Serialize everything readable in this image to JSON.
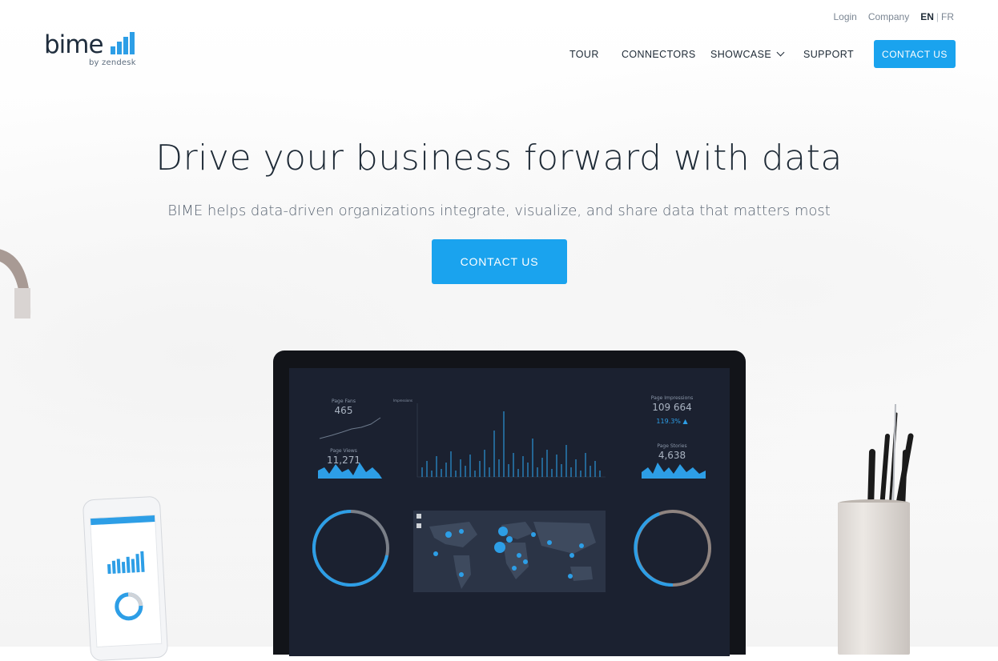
{
  "brand": {
    "logo_word": "bime",
    "logo_sub": "by zendesk",
    "accent": "#1aa3ee"
  },
  "utility_nav": {
    "login": "Login",
    "company": "Company",
    "lang_active": "EN",
    "separator": "|",
    "lang_other": "FR"
  },
  "nav": {
    "items": [
      {
        "label": "TOUR"
      },
      {
        "label": "CONNECTORS"
      },
      {
        "label": "SHOWCASE",
        "icon": "chevron-down-icon"
      },
      {
        "label": "SUPPORT"
      }
    ],
    "cta": "CONTACT US"
  },
  "hero": {
    "title": "Drive your business forward with data",
    "subtitle": "BIME helps data-driven organizations integrate, visualize, and share data that matters most",
    "cta": "CONTACT US"
  },
  "dashboard": {
    "page_fans_label": "Page Fans",
    "page_fans_value": "465",
    "page_views_label": "Page Views",
    "page_views_value": "11,271",
    "impressions_chart_label": "Impressions",
    "page_impressions_label": "Page Impressions",
    "page_impressions_value": "109 664",
    "page_impressions_change": "119.3% ▲",
    "page_stories_label": "Page Stories",
    "page_stories_value": "4,638"
  }
}
